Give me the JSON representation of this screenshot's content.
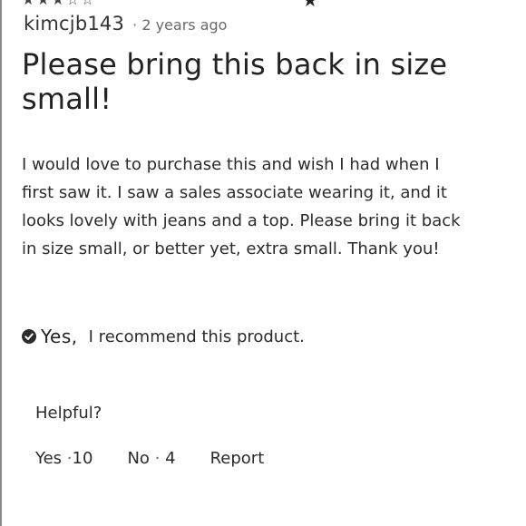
{
  "rating_top": {
    "stars_left": "★★★☆☆",
    "star_right": "★",
    "glyph_right": "✓"
  },
  "review": {
    "username": "kimcjb143",
    "timestamp": "· 2 years ago",
    "title": "Please bring this back in size small!",
    "body": "I would love to purchase this and wish I had when I first saw it. I saw a sales associate wearing it, and it looks lovely with jeans and a top. Please bring it back in size small, or better yet, extra small. Thank you!",
    "recommend_yes": "Yes,",
    "recommend_text": "I recommend this product."
  },
  "helpful": {
    "label": "Helpful?",
    "yes_label": "Yes",
    "yes_count": "10",
    "no_label": "No",
    "no_count": "4",
    "separator": "·",
    "report_label": "Report"
  },
  "colors": {
    "text": "#222222",
    "muted": "#6a6a6a",
    "rule": "#8a8a8a"
  },
  "icons": {
    "recommend": "check-circle-icon"
  }
}
